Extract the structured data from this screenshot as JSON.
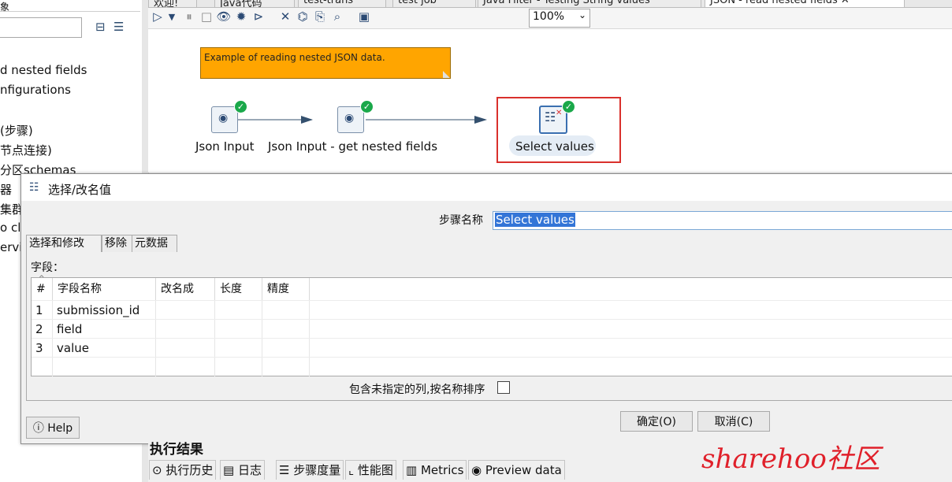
{
  "left_panel": {
    "top_text": "象",
    "items": [
      "d nested fields",
      "nfigurations",
      "(步骤)",
      "节点连接)",
      "分区schemas",
      "器",
      "集群s",
      "o clu",
      "ervic"
    ]
  },
  "editor_tabs": [
    {
      "label": "欢迎!"
    },
    {
      "label": "Java代码"
    },
    {
      "label": "test-trans"
    },
    {
      "label": "test job"
    },
    {
      "label": "Java Filter - Testing String values"
    },
    {
      "label": "JSON - read nested fields ✕"
    }
  ],
  "toolbar": {
    "zoom": "100%",
    "icons": [
      "run-icon",
      "run-dropdown-icon",
      "pause-icon",
      "stop-icon",
      "preview-icon",
      "debug-icon",
      "replay-icon",
      "verify-icon",
      "impact-icon",
      "sql-icon",
      "explore-db-icon",
      "show-results-icon"
    ]
  },
  "canvas": {
    "note": "Example of reading nested JSON data.",
    "steps": [
      {
        "label": "Json Input"
      },
      {
        "label": "Json Input - get nested fields"
      },
      {
        "label": "Select values"
      }
    ]
  },
  "dialog": {
    "title": "选择/改名值",
    "step_name_label": "步骤名称",
    "step_name_value": "Select values",
    "tabs": [
      "选择和修改",
      "移除",
      "元数据"
    ],
    "fields_label": "字段：",
    "columns": [
      "#",
      "字段名称",
      "改名成",
      "长度",
      "精度"
    ],
    "rows": [
      {
        "num": "1",
        "name": "submission_id"
      },
      {
        "num": "2",
        "name": "field"
      },
      {
        "num": "3",
        "name": "value"
      }
    ],
    "include_unspecified_label": "包含未指定的列,按名称排序",
    "help_label": "Help",
    "ok_label": "确定(O)",
    "cancel_label": "取消(C)"
  },
  "bottom": {
    "title": "执行结果",
    "tabs": [
      "执行历史",
      "日志",
      "步骤度量",
      "性能图",
      "Metrics",
      "Preview data"
    ]
  },
  "watermark": "sharehoo社区",
  "colors": {
    "note_bg": "#ffa500",
    "highlight_border": "#d9302c",
    "ok_badge": "#1aa84a"
  }
}
